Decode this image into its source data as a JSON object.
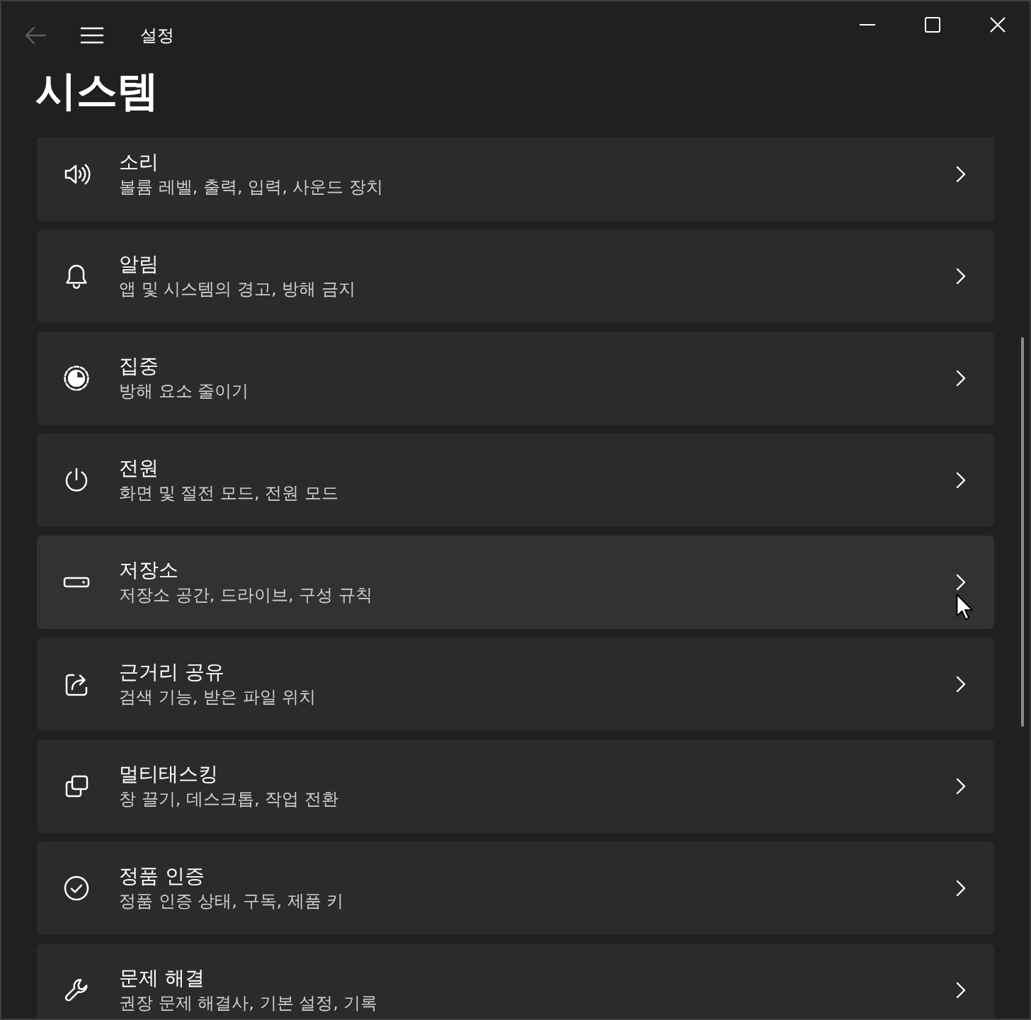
{
  "window": {
    "title": "설정",
    "back_button": {
      "disabled": true
    }
  },
  "page_title": "시스템",
  "items": [
    {
      "kind": "sound",
      "title": "소리",
      "subtitle": "볼륨 레벨, 출력, 입력, 사운드 장치",
      "hovered": false
    },
    {
      "kind": "notifications",
      "title": "알림",
      "subtitle": "앱 및 시스템의 경고, 방해 금지",
      "hovered": false
    },
    {
      "kind": "focus",
      "title": "집중",
      "subtitle": "방해 요소 줄이기",
      "hovered": false
    },
    {
      "kind": "power",
      "title": "전원",
      "subtitle": "화면 및 절전 모드, 전원 모드",
      "hovered": false
    },
    {
      "kind": "storage",
      "title": "저장소",
      "subtitle": "저장소 공간, 드라이브, 구성 규칙",
      "hovered": true
    },
    {
      "kind": "sharing",
      "title": "근거리 공유",
      "subtitle": "검색 기능, 받은 파일 위치",
      "hovered": false
    },
    {
      "kind": "multitasking",
      "title": "멀티태스킹",
      "subtitle": "창 끌기, 데스크톱, 작업 전환",
      "hovered": false
    },
    {
      "kind": "activation",
      "title": "정품 인증",
      "subtitle": "정품 인증 상태, 구독, 제품 키",
      "hovered": false
    },
    {
      "kind": "troubleshoot",
      "title": "문제 해결",
      "subtitle": "권장 문제 해결사, 기본 설정, 기록",
      "hovered": false
    }
  ]
}
